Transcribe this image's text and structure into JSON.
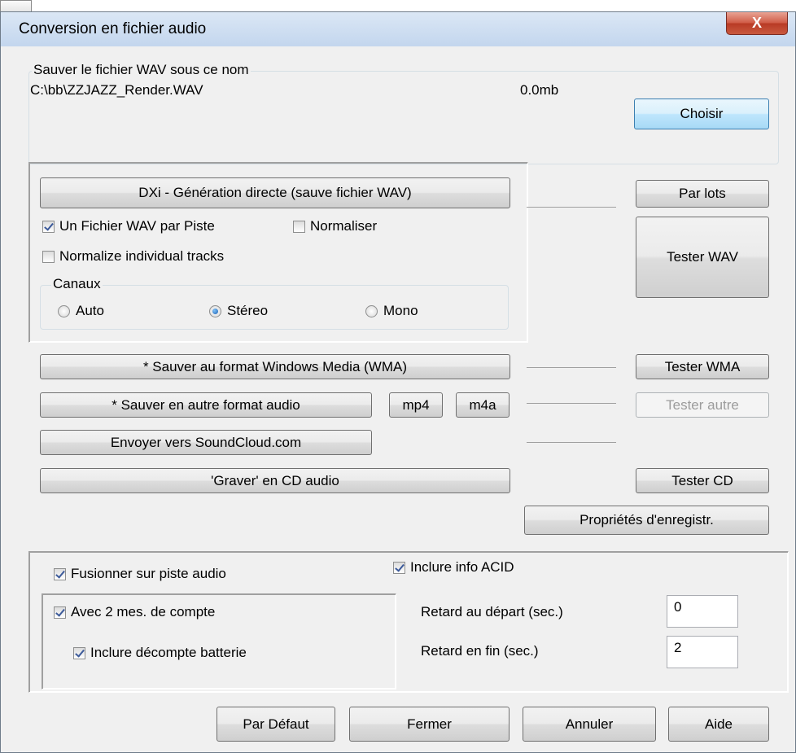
{
  "dialog": {
    "title": "Conversion en fichier audio",
    "close_symbol": "X"
  },
  "save_group": {
    "legend": "Sauver le fichier WAV sous ce nom",
    "path": "C:\\bb\\ZZJAZZ_Render.WAV",
    "size": "0.0mb",
    "choose_button": "Choisir"
  },
  "dxi_group": {
    "render_button": "DXi - Génération directe (sauve fichier WAV)",
    "one_wav_per_track": {
      "label": "Un Fichier WAV par Piste",
      "checked": true
    },
    "normalize": {
      "label": "Normaliser",
      "checked": false
    },
    "normalize_tracks": {
      "label": "Normalize individual tracks",
      "checked": false
    },
    "channels": {
      "legend": "Canaux",
      "options": [
        "Auto",
        "Stéreo",
        "Mono"
      ],
      "selected": "Stéreo"
    }
  },
  "right_buttons": {
    "batch": "Par lots",
    "test_wav": "Tester WAV",
    "test_wma": "Tester WMA",
    "test_other": "Tester autre",
    "test_cd": "Tester CD",
    "record_props": "Propriétés d'enregistr."
  },
  "format_buttons": {
    "wma": "* Sauver au format Windows Media (WMA)",
    "other": "* Sauver en autre format audio",
    "mp4": "mp4",
    "m4a": "m4a",
    "soundcloud": "Envoyer vers SoundCloud.com",
    "burn_cd": "'Graver' en CD audio"
  },
  "options": {
    "merge": {
      "label": "Fusionner sur piste audio",
      "checked": true
    },
    "acid": {
      "label": "Inclure info ACID",
      "checked": true
    },
    "count_in": {
      "label": "Avec 2 mes. de compte",
      "checked": true
    },
    "drum_count": {
      "label": "Inclure décompte batterie",
      "checked": true
    },
    "start_delay": {
      "label": "Retard au départ (sec.)",
      "value": "0"
    },
    "end_delay": {
      "label": "Retard en fin (sec.)",
      "value": "2"
    }
  },
  "footer": {
    "defaults": "Par Défaut",
    "close": "Fermer",
    "cancel": "Annuler",
    "help": "Aide"
  }
}
